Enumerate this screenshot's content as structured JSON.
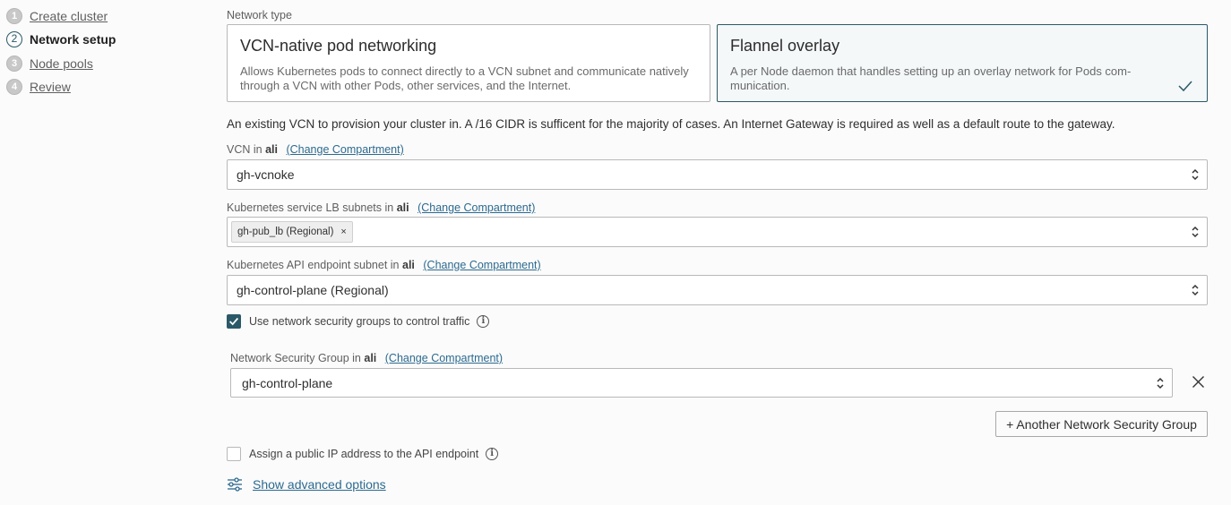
{
  "sidebar": {
    "steps": [
      {
        "num": "1",
        "label": "Create cluster"
      },
      {
        "num": "2",
        "label": "Network setup"
      },
      {
        "num": "3",
        "label": "Node pools"
      },
      {
        "num": "4",
        "label": "Review"
      }
    ]
  },
  "network_type": {
    "label": "Network type",
    "options": [
      {
        "title": "VCN-native pod networking",
        "desc": "Allows Kubernetes pods to connect directly to a VCN subnet and communicate natively through a VCN with other Pods, other services, and the Internet."
      },
      {
        "title": "Flannel overlay",
        "desc": "A per Node daemon that handles setting up an overlay network for Pods com-munication."
      }
    ]
  },
  "vcn_help": "An existing VCN to provision your cluster in. A /16 CIDR is sufficent for the majority of cases. An Internet Gateway is required as well as a default route to the gateway.",
  "compartment": "ali",
  "change_compartment": "(Change Compartment)",
  "vcn": {
    "label": "VCN in",
    "value": "gh-vcnoke"
  },
  "lb_subnets": {
    "label": "Kubernetes service LB subnets in",
    "chip": "gh-pub_lb (Regional)",
    "chip_remove": "×"
  },
  "api_subnet": {
    "label": "Kubernetes API endpoint subnet in",
    "value": "gh-control-plane (Regional)"
  },
  "nsg_checkbox": {
    "label": "Use network security groups to control traffic",
    "checked": true
  },
  "nsg": {
    "label": "Network Security Group in",
    "value": "gh-control-plane"
  },
  "add_nsg_button": "+ Another Network Security Group",
  "public_ip": {
    "label": "Assign a public IP address to the API endpoint",
    "checked": false
  },
  "advanced": "Show advanced options",
  "info_glyph": "i",
  "colors": {
    "accent": "#2c5967",
    "link": "#2c6a8f"
  }
}
